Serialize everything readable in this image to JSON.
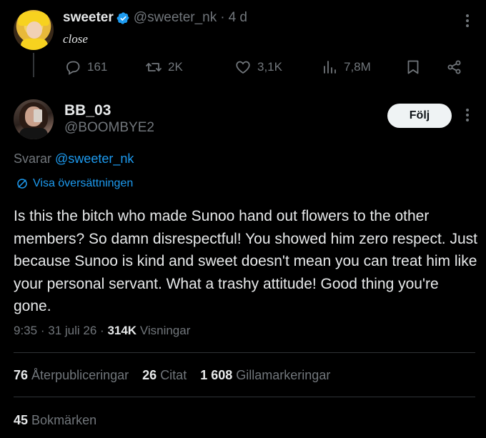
{
  "parent_tweet": {
    "display_name": "sweeter",
    "handle": "@sweeter_nk",
    "time_separator": "·",
    "time_ago": "4 d",
    "text": "close",
    "actions": {
      "replies": "161",
      "retweets": "2K",
      "likes": "3,1K",
      "views": "7,8M"
    }
  },
  "reply_tweet": {
    "display_name": "BB_03",
    "handle": "@BOOMBYE2",
    "follow_label": "Följ",
    "replying_to_prefix": "Svarar",
    "replying_to_handle": "@sweeter_nk",
    "translate_label": "Visa översättningen",
    "body": "Is this the bitch who made Sunoo hand out flowers to the other members? So damn disrespectful! You showed him zero respect. Just because Sunoo is kind and sweet doesn't mean you can treat him like your personal servant. What a trashy attitude! Good thing you're gone.",
    "time": "9:35",
    "sep": "·",
    "date": "31 juli 26",
    "views_count": "314K",
    "views_label": "Visningar"
  },
  "stats": {
    "reposts_count": "76",
    "reposts_label": "Återpubliceringar",
    "quotes_count": "26",
    "quotes_label": "Citat",
    "likes_count": "1 608",
    "likes_label": "Gillamarkeringar",
    "bookmarks_count": "45",
    "bookmarks_label": "Bokmärken"
  },
  "colors": {
    "background": "#000000",
    "text": "#e7e9ea",
    "muted": "#71767b",
    "accent": "#1d9bf0",
    "divider": "#2f3336"
  }
}
